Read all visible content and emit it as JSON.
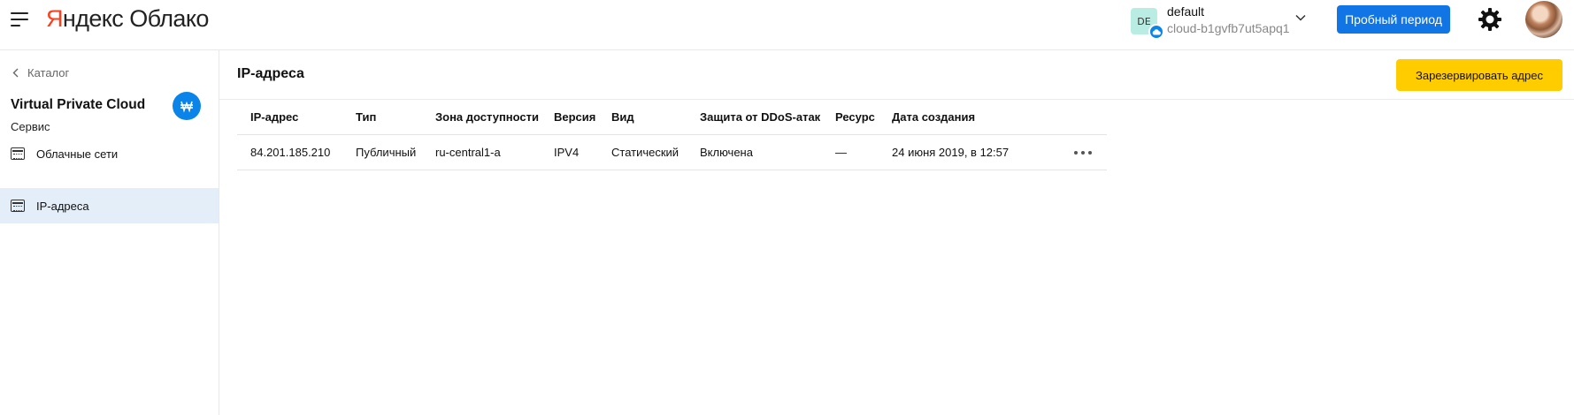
{
  "header": {
    "logo": {
      "brand_first": "Я",
      "brand_rest": "ндекс",
      "product": "Облако"
    },
    "cloud": {
      "avatar_text": "DE",
      "name": "default",
      "id": "cloud-b1gvfb7ut5apq1"
    },
    "trial_label": "Пробный период",
    "icons": {
      "menu": "hamburger-icon",
      "settings": "gear-icon",
      "chevron": "chevron-down-icon"
    }
  },
  "sidebar": {
    "back_label": "Каталог",
    "service_title": "Virtual Private Cloud",
    "service_subtitle": "Сервис",
    "items": [
      {
        "label": "Облачные сети",
        "active": false
      },
      {
        "label": "IP-адреса",
        "active": true
      }
    ]
  },
  "main": {
    "title": "IP-адреса",
    "reserve_label": "Зарезервировать адрес",
    "table": {
      "columns": [
        "IP-адрес",
        "Тип",
        "Зона доступности",
        "Версия",
        "Вид",
        "Защита от DDoS-атак",
        "Ресурс",
        "Дата создания"
      ],
      "rows": [
        [
          "84.201.185.210",
          "Публичный",
          "ru-central1-a",
          "IPV4",
          "Статический",
          "Включена",
          "—",
          "24 июня 2019, в 12:57"
        ]
      ]
    }
  },
  "colors": {
    "accent_blue": "#1275e6",
    "yellow": "#ffcc00",
    "brand_red": "#fc3f1d",
    "active_nav": "#e4eef8"
  }
}
